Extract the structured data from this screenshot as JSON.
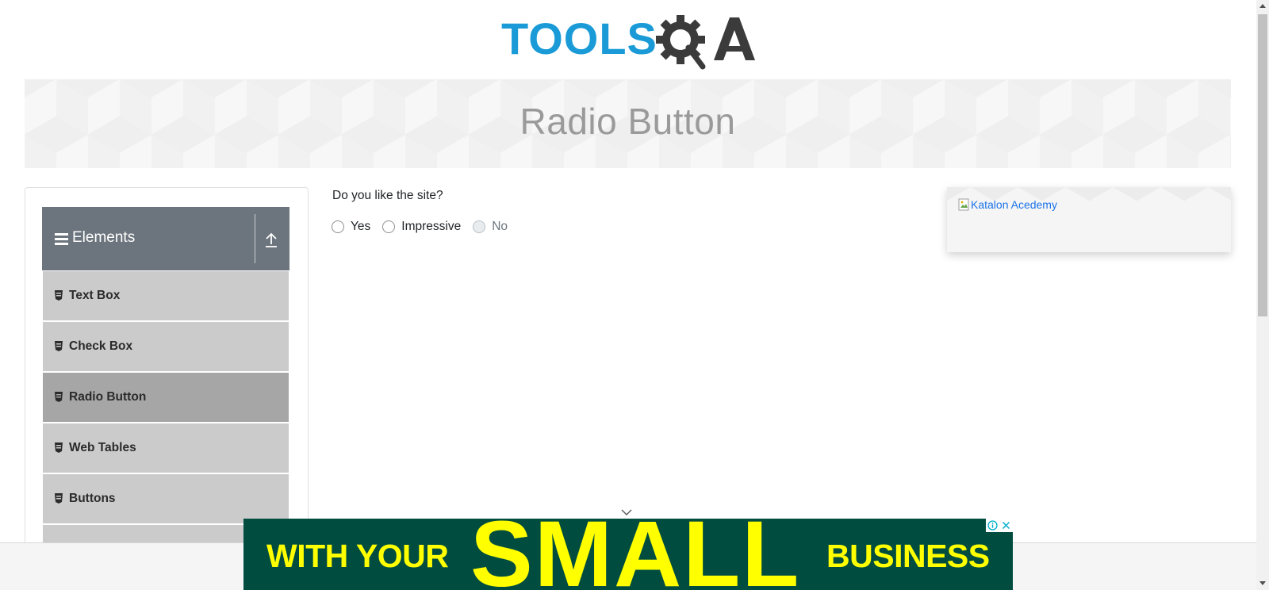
{
  "header": {
    "logo_text_part1": "TOOLS",
    "logo_text_part2": "QA"
  },
  "banner": {
    "title": "Radio Button"
  },
  "sidebar": {
    "group_title": "Elements",
    "items": [
      {
        "label": "Text Box",
        "active": false
      },
      {
        "label": "Check Box",
        "active": false
      },
      {
        "label": "Radio Button",
        "active": true
      },
      {
        "label": "Web Tables",
        "active": false
      },
      {
        "label": "Buttons",
        "active": false
      }
    ]
  },
  "main": {
    "question": "Do you like the site?",
    "options": [
      {
        "label": "Yes",
        "disabled": false
      },
      {
        "label": "Impressive",
        "disabled": false
      },
      {
        "label": "No",
        "disabled": true
      }
    ]
  },
  "ad_card": {
    "alt_text": "Katalon Acedemy"
  },
  "bottom_ad": {
    "text_left": "WITH YOUR",
    "text_big": "SMALL",
    "text_right": "BUSINESS"
  },
  "colors": {
    "logo_blue": "#1a9bd7",
    "logo_dark": "#3b3b3b",
    "group_header": "#6c757d",
    "menu_item": "#cbcbcb",
    "menu_item_active": "#a6a6a6",
    "ad_green": "#004c3f",
    "ad_yellow": "#ffff00"
  }
}
